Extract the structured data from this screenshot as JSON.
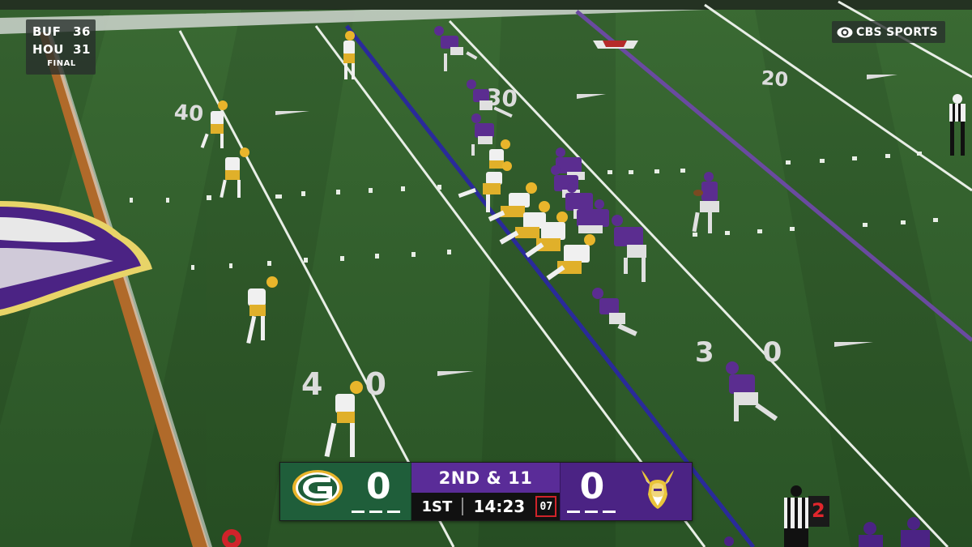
{
  "broadcast": {
    "network": "CBS SPORTS",
    "ticker": {
      "rows": [
        {
          "team": "BUF",
          "score": "36"
        },
        {
          "team": "HOU",
          "score": "31"
        }
      ],
      "status": "FINAL"
    }
  },
  "field_numbers": {
    "left_forty": "40",
    "center_thirty": "30",
    "right_twenty": "20",
    "lower_forty": "40",
    "lower_thirty": "30"
  },
  "scorebug": {
    "away": {
      "logo": "packers-g-logo",
      "score": "0",
      "timeouts_remaining": 3,
      "color": "#1f5e3a"
    },
    "home": {
      "logo": "vikings-helmet-logo",
      "score": "0",
      "timeouts_remaining": 3,
      "color": "#4b2384"
    },
    "down_distance": "2ND & 11",
    "quarter": "1ST",
    "game_clock": "14:23",
    "play_clock": "07"
  },
  "sideline": {
    "down_marker": "2"
  },
  "colors": {
    "turf": "#2f5a2a",
    "scrimmage_line": "#2a2a9a",
    "first_down_line": "#6a4aa0",
    "packers_green": "#1f5e3a",
    "vikings_purple": "#4b2384"
  }
}
